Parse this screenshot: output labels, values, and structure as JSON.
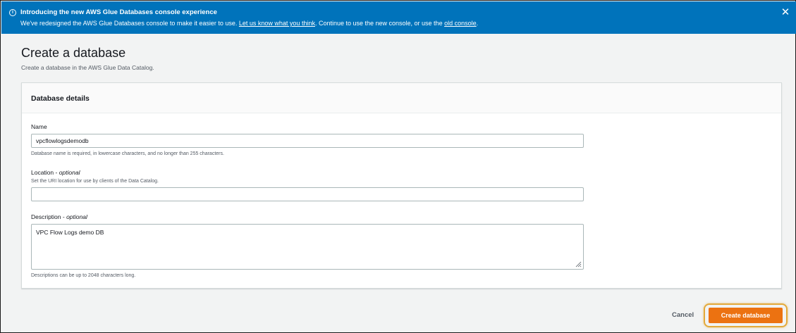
{
  "banner": {
    "title": "Introducing the new AWS Glue Databases console experience",
    "text_before": "We've redesigned the AWS Glue Databases console to make it easier to use. ",
    "feedback_link": "Let us know what you think",
    "text_middle": ". Continue to use the new console, or use the ",
    "old_console_link": "old console",
    "text_after": ".",
    "icon": "info-icon",
    "close_icon": "close-icon",
    "color": "#0073bb"
  },
  "page": {
    "title": "Create a database",
    "subtitle": "Create a database in the AWS Glue Data Catalog."
  },
  "details": {
    "heading": "Database details",
    "name": {
      "label": "Name",
      "value": "vpcflowlogsdemodb",
      "hint": "Database name is required, in lowercase characters, and no longer than 255 characters."
    },
    "location": {
      "label": "Location - ",
      "optional": "optional",
      "description": "Set the URI location for use by clients of the Data Catalog.",
      "value": ""
    },
    "description": {
      "label": "Description - ",
      "optional": "optional",
      "value": "VPC Flow Logs demo DB",
      "hint": "Descriptions can be up to 2048 characters long."
    }
  },
  "actions": {
    "cancel": "Cancel",
    "create": "Create database",
    "create_color": "#ec7211",
    "highlight_color": "#e3a93a"
  }
}
